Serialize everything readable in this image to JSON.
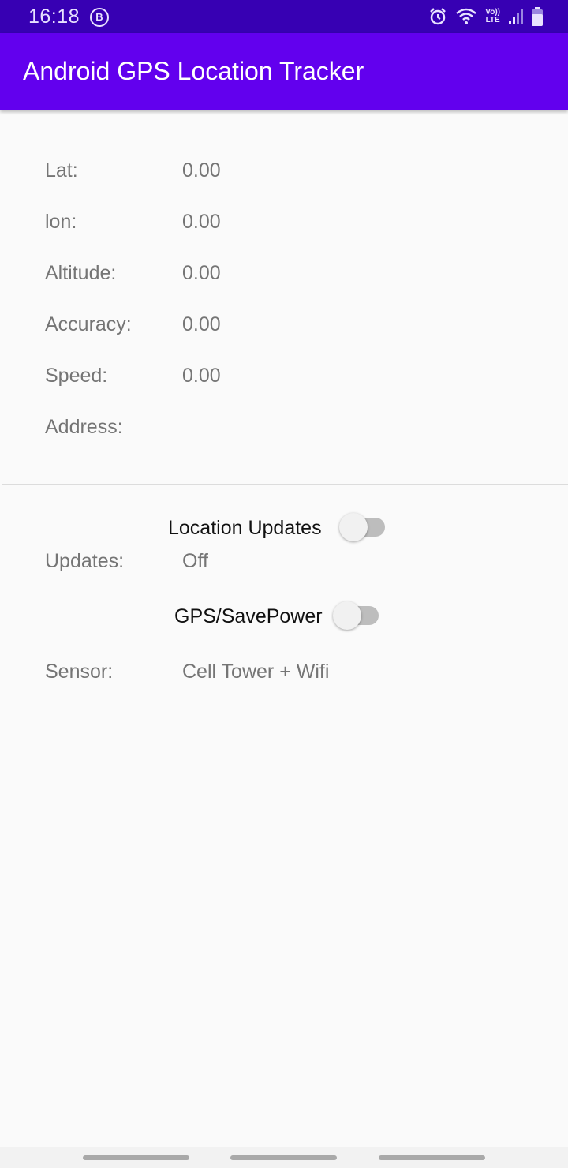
{
  "status_bar": {
    "time": "16:18",
    "notification_badge": "B",
    "volte_top": "Vo))",
    "volte_bottom": "LTE",
    "icons": [
      "alarm-icon",
      "wifi-icon",
      "volte-icon",
      "cell-signal-icon",
      "battery-icon"
    ]
  },
  "app_bar": {
    "title": "Android GPS Location Tracker",
    "color": "#6200ee"
  },
  "location": [
    {
      "label": "Lat:",
      "value": "0.00"
    },
    {
      "label": "lon:",
      "value": "0.00"
    },
    {
      "label": "Altitude:",
      "value": "0.00"
    },
    {
      "label": "Accuracy:",
      "value": "0.00"
    },
    {
      "label": "Speed:",
      "value": "0.00"
    },
    {
      "label": "Address:",
      "value": ""
    }
  ],
  "controls": {
    "location_updates_label": "Location Updates",
    "location_updates_on": false,
    "updates_label": "Updates:",
    "updates_value": "Off",
    "gps_savepower_label": "GPS/SavePower",
    "gps_savepower_on": false,
    "sensor_label": "Sensor:",
    "sensor_value": "Cell Tower + Wifi"
  },
  "colors": {
    "status_bar": "#3700b3",
    "primary": "#6200ee",
    "background": "#fafafa",
    "text_secondary": "#757575"
  }
}
